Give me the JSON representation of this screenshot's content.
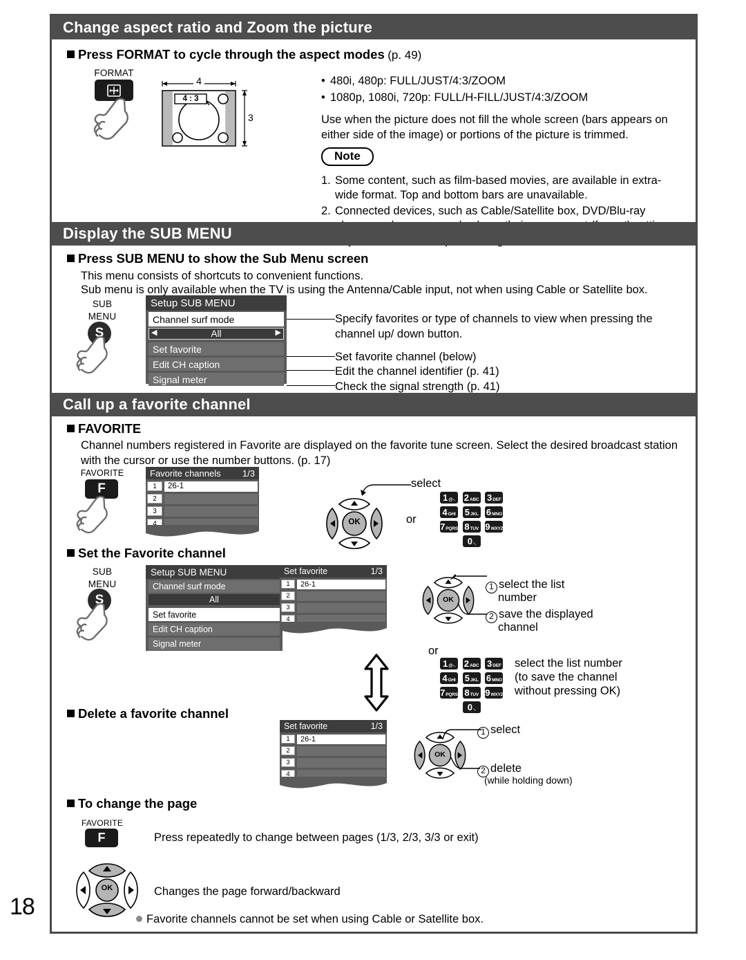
{
  "page_number": "18",
  "sections": {
    "aspect": {
      "bar_title": "Change aspect ratio and Zoom the picture",
      "heading": "Press FORMAT to cycle through the aspect modes",
      "heading_ref": "(p. 49)",
      "format_key_label": "FORMAT",
      "tv_ratio_label": "4 : 3",
      "tv_width_label": "4",
      "tv_height_label": "3",
      "modes": [
        "480i, 480p:  FULL/JUST/4:3/ZOOM",
        "1080p, 1080i, 720p:  FULL/H-FILL/JUST/4:3/ZOOM"
      ],
      "description": "Use when the picture does not fill the whole screen (bars appears on either side of the image) or portions of the picture is trimmed.",
      "note_label": "Note",
      "notes": [
        {
          "n": "1.",
          "text": "Some content, such as film-based movies, are available in extra-wide format. Top and bottom bars are unavailable."
        },
        {
          "n": "2.",
          "text": "Connected devices, such as Cable/Satellite box, DVD/Blu-ray players and game consoles have their own aspect (format) settings. Adjust the device’s aspect settings."
        }
      ]
    },
    "submenu": {
      "bar_title": "Display the SUB MENU",
      "heading": "Press SUB MENU to show the Sub Menu screen",
      "lines": [
        "This menu consists of shortcuts to convenient functions.",
        "Sub menu is only available when the TV is using the Antenna/Cable input, not when using Cable or Satellite box."
      ],
      "key_label_1": "SUB",
      "key_label_2": "MENU",
      "key_glyph": "S",
      "osd": {
        "title": "Setup SUB MENU",
        "rows": [
          {
            "label": "Channel surf mode",
            "style": "white"
          },
          {
            "label": "All",
            "style": "selector"
          },
          {
            "label": "Set favorite",
            "style": "grey"
          },
          {
            "label": "Edit CH caption",
            "style": "grey"
          },
          {
            "label": "Signal meter",
            "style": "grey"
          }
        ]
      },
      "callouts": [
        "Specify favorites or type of channels to view when pressing the channel up/ down button.",
        "Set favorite channel (below)",
        "Edit the channel identifier (p. 41)",
        "Check the signal strength (p. 41)"
      ]
    },
    "favorite": {
      "bar_title": "Call up a favorite channel",
      "heading": "FAVORITE",
      "description": "Channel numbers registered in Favorite are displayed on the favorite tune screen. Select the desired broadcast station with the cursor or use the number buttons. (p. 17)",
      "key_label": "FAVORITE",
      "key_glyph": "F",
      "osd": {
        "title": "Favorite channels",
        "page": "1/3",
        "items": [
          {
            "num": "1",
            "value": "26-1",
            "style": "white"
          },
          {
            "num": "2",
            "value": "",
            "style": "grey"
          },
          {
            "num": "3",
            "value": "",
            "style": "grey"
          },
          {
            "num": "4",
            "value": "",
            "style": "grey"
          }
        ]
      },
      "select_label": "select",
      "or_label": "or"
    },
    "set_favorite": {
      "heading": "Set the Favorite channel",
      "key_label_1": "SUB",
      "key_label_2": "MENU",
      "key_glyph": "S",
      "osd_menu": {
        "title": "Setup SUB MENU",
        "rows": [
          {
            "label": "Channel surf mode",
            "style": "grey"
          },
          {
            "label": "All",
            "style": "dark"
          },
          {
            "label": "Set favorite",
            "style": "white"
          },
          {
            "label": "Edit CH caption",
            "style": "grey"
          },
          {
            "label": "Signal meter",
            "style": "grey"
          }
        ]
      },
      "osd_list": {
        "title": "Set favorite",
        "page": "1/3",
        "items": [
          {
            "num": "1",
            "value": "26-1",
            "style": "white"
          },
          {
            "num": "2",
            "value": "",
            "style": "grey"
          },
          {
            "num": "3",
            "value": "",
            "style": "grey"
          },
          {
            "num": "4",
            "value": "",
            "style": "grey"
          }
        ]
      },
      "step1_a": "select the list",
      "step1_b": "number",
      "step2_a": "save the displayed",
      "step2_b": "channel",
      "or_label": "or",
      "keypad_note": [
        "select the list number",
        "(to save the channel",
        "without pressing OK)"
      ]
    },
    "delete_favorite": {
      "heading": "Delete a favorite channel",
      "osd_list": {
        "title": "Set favorite",
        "page": "1/3",
        "items": [
          {
            "num": "1",
            "value": "26-1",
            "style": "white"
          },
          {
            "num": "2",
            "value": "",
            "style": "grey"
          },
          {
            "num": "3",
            "value": "",
            "style": "grey"
          },
          {
            "num": "4",
            "value": "",
            "style": "grey"
          }
        ]
      },
      "step1": "select",
      "step2": "delete",
      "step2_sub": "(while holding down)"
    },
    "change_page": {
      "heading": "To change the page",
      "key_label": "FAVORITE",
      "key_glyph": "F",
      "line1": "Press repeatedly to change between pages (1/3, 2/3, 3/3 or exit)",
      "line2": "Changes the page forward/backward",
      "footnote": "Favorite channels cannot be set when using Cable or Satellite box."
    }
  },
  "keypad": [
    {
      "num": "1",
      "sub": "@-."
    },
    {
      "num": "2",
      "sub": "ABC"
    },
    {
      "num": "3",
      "sub": "DEF"
    },
    {
      "num": "4",
      "sub": "GHI"
    },
    {
      "num": "5",
      "sub": "JKL"
    },
    {
      "num": "6",
      "sub": "MNO"
    },
    {
      "num": "7",
      "sub": "PQRS"
    },
    {
      "num": "8",
      "sub": "TUV"
    },
    {
      "num": "9",
      "sub": "WXYZ"
    },
    {
      "num": "0",
      "sub": "-,"
    }
  ],
  "dpad": {
    "ok": "OK"
  }
}
